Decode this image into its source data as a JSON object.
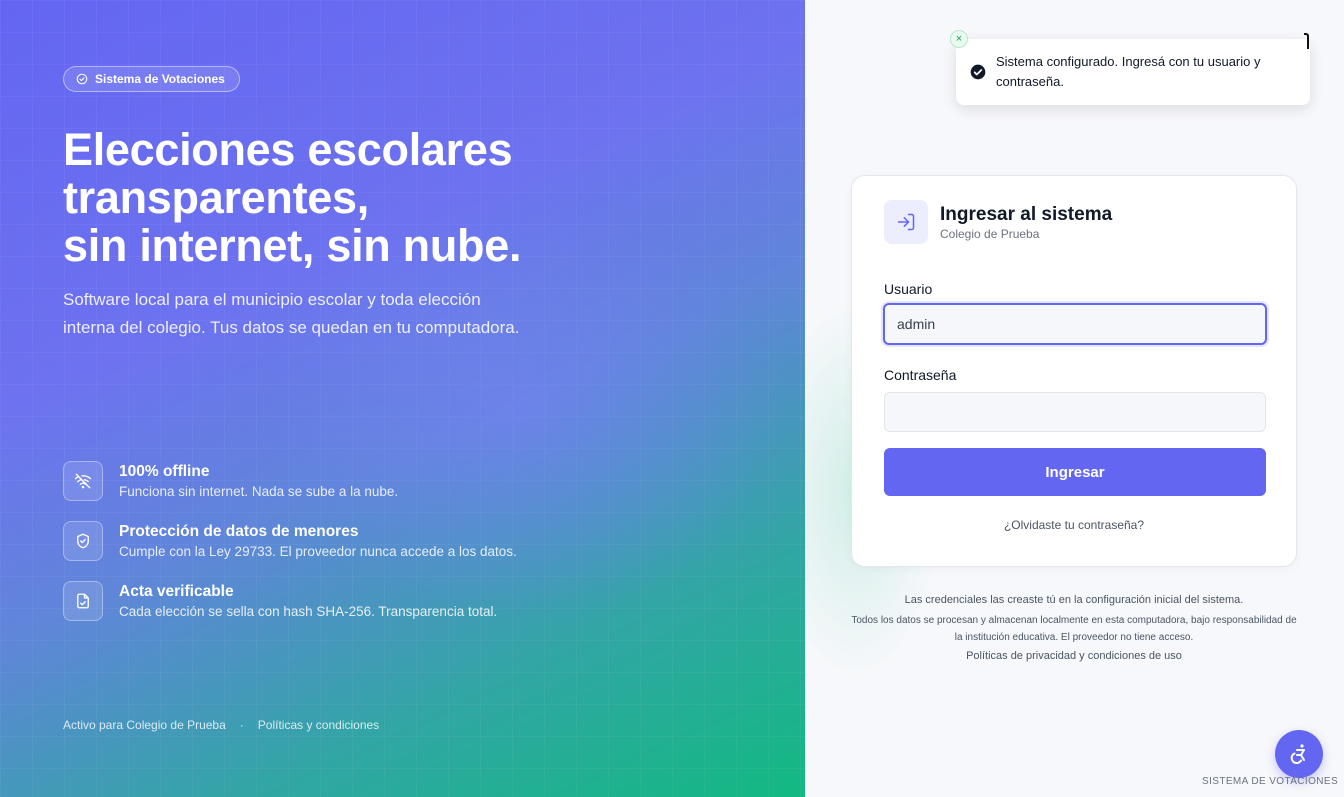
{
  "hero": {
    "badge": "Sistema de Votaciones",
    "headline": [
      "Elecciones escolares",
      "transparentes,",
      "sin internet, sin nube."
    ],
    "subtitle": "Software local para el municipio escolar y toda elección interna del colegio. Tus datos se quedan en tu computadora.",
    "features": [
      {
        "icon": "wifi-off-icon",
        "title": "100% offline",
        "desc": "Funciona sin internet. Nada se sube a la nube."
      },
      {
        "icon": "shield-check-icon",
        "title": "Protección de datos de menores",
        "desc": "Cumple con la Ley 29733. El proveedor nunca accede a los datos."
      },
      {
        "icon": "file-check-icon",
        "title": "Acta verificable",
        "desc": "Cada elección se sella con hash SHA-256. Transparencia total."
      }
    ],
    "footer": {
      "active": "Activo para Colegio de Prueba",
      "separator": "·",
      "policies": "Políticas y condiciones"
    }
  },
  "toast": {
    "message": "Sistema configurado. Ingresá con tu usuario y contraseña.",
    "close": "×"
  },
  "login": {
    "title": "Ingresar al sistema",
    "subtitle": "Colegio de Prueba",
    "username_label": "Usuario",
    "username_value": "admin",
    "password_label": "Contraseña",
    "password_value": "",
    "submit": "Ingresar",
    "forgot": "¿Olvidaste tu contraseña?"
  },
  "notes": {
    "credentials": "Las credenciales las creaste tú en la configuración inicial del sistema.",
    "privacy": "Todos los datos se procesan y almacenan localmente en esta computadora, bajo responsabilidad de la institución educativa. El proveedor no tiene acceso.",
    "policies_link": "Políticas de privacidad y condiciones de uso"
  },
  "footer_brand": "SISTEMA DE VOTACIONES",
  "colors": {
    "primary": "#6366f1",
    "accent_green": "#10b981"
  }
}
